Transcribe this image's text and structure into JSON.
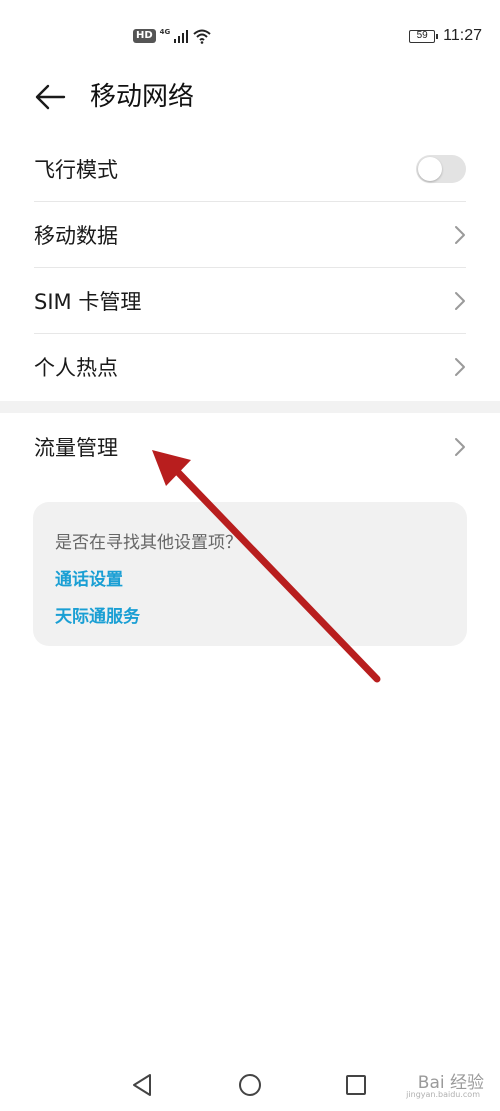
{
  "status": {
    "hd": "HD",
    "network": "4G",
    "battery": "59",
    "time": "11:27"
  },
  "header": {
    "title": "移动网络"
  },
  "settings": {
    "airplane": "飞行模式",
    "mobile_data": "移动数据",
    "sim": "SIM 卡管理",
    "hotspot": "个人热点",
    "traffic": "流量管理"
  },
  "suggest": {
    "question": "是否在寻找其他设置项？",
    "link1": "通话设置",
    "link2": "天际通服务"
  },
  "watermark": {
    "text": "Bai 经验",
    "sub": "jingyan.baidu.com"
  },
  "colors": {
    "accent_link": "#1a9fd4",
    "annotation_arrow": "#b81e1e"
  }
}
